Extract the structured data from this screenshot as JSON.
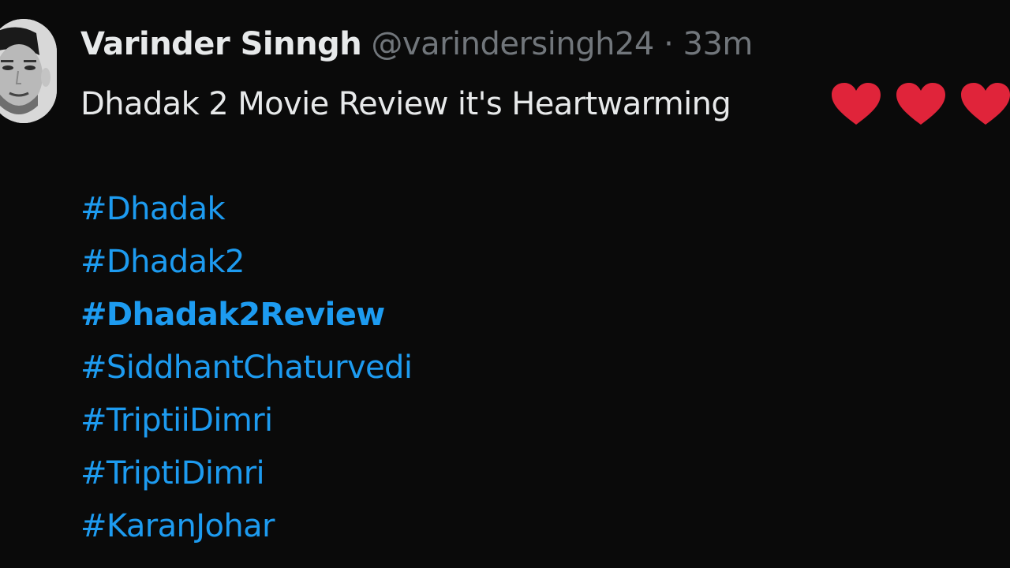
{
  "tweet": {
    "author_name": "Varinder Sinngh",
    "handle": "@varindersingh24",
    "separator": "·",
    "timestamp": "33m",
    "text": "Dhadak 2 Movie Review it's Heartwarming",
    "emoji": [
      "heart-icon",
      "heart-icon",
      "heart-icon"
    ],
    "hashtags": [
      {
        "label": "#Dhadak",
        "bold": false
      },
      {
        "label": "#Dhadak2",
        "bold": false
      },
      {
        "label": "#Dhadak2Review",
        "bold": true
      },
      {
        "label": "#SiddhantChaturvedi",
        "bold": false
      },
      {
        "label": "#TriptiiDimri",
        "bold": false
      },
      {
        "label": "#TriptiDimri",
        "bold": false
      },
      {
        "label": "#KaranJohar",
        "bold": false
      }
    ]
  },
  "colors": {
    "background": "#0a0a0a",
    "primary_text": "#e7e9ea",
    "secondary_text": "#71767b",
    "link": "#1d9bf0",
    "heart": "#e0243a"
  }
}
